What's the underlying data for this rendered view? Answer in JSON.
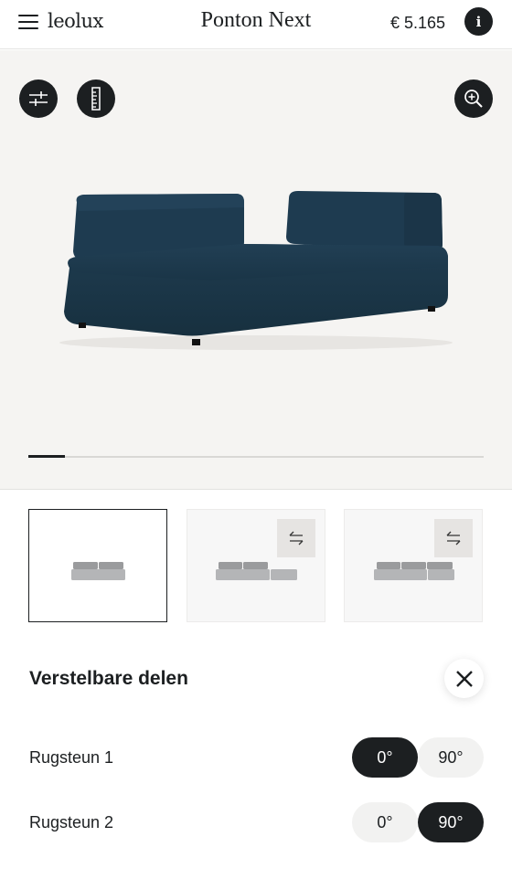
{
  "header": {
    "logo": "leolux",
    "title": "Ponton Next",
    "price": "€ 5.165",
    "info_icon_label": "i"
  },
  "viewer": {
    "background": "#f5f4f2",
    "sofa_color": "#1d3b4f",
    "progress_fraction": 0.08
  },
  "thumbnails": [
    {
      "name": "configuration-1",
      "selected": true,
      "has_swap": false
    },
    {
      "name": "configuration-2",
      "selected": false,
      "has_swap": true
    },
    {
      "name": "configuration-3",
      "selected": false,
      "has_swap": true
    }
  ],
  "panel": {
    "title": "Verstelbare delen",
    "rows": [
      {
        "label": "Rugsteun 1",
        "options": [
          "0°",
          "90°"
        ],
        "selected": "0°"
      },
      {
        "label": "Rugsteun 2",
        "options": [
          "0°",
          "90°"
        ],
        "selected": "90°"
      }
    ]
  },
  "icons": {
    "menu": "hamburger-icon",
    "info": "info-icon",
    "filters": "sliders-icon",
    "measure": "ruler-icon",
    "zoom": "zoom-in-icon",
    "swap": "swap-arrows-icon",
    "close": "close-icon"
  },
  "colors": {
    "accent": "#1c1f21",
    "pill_inactive": "#f2f2f1"
  }
}
